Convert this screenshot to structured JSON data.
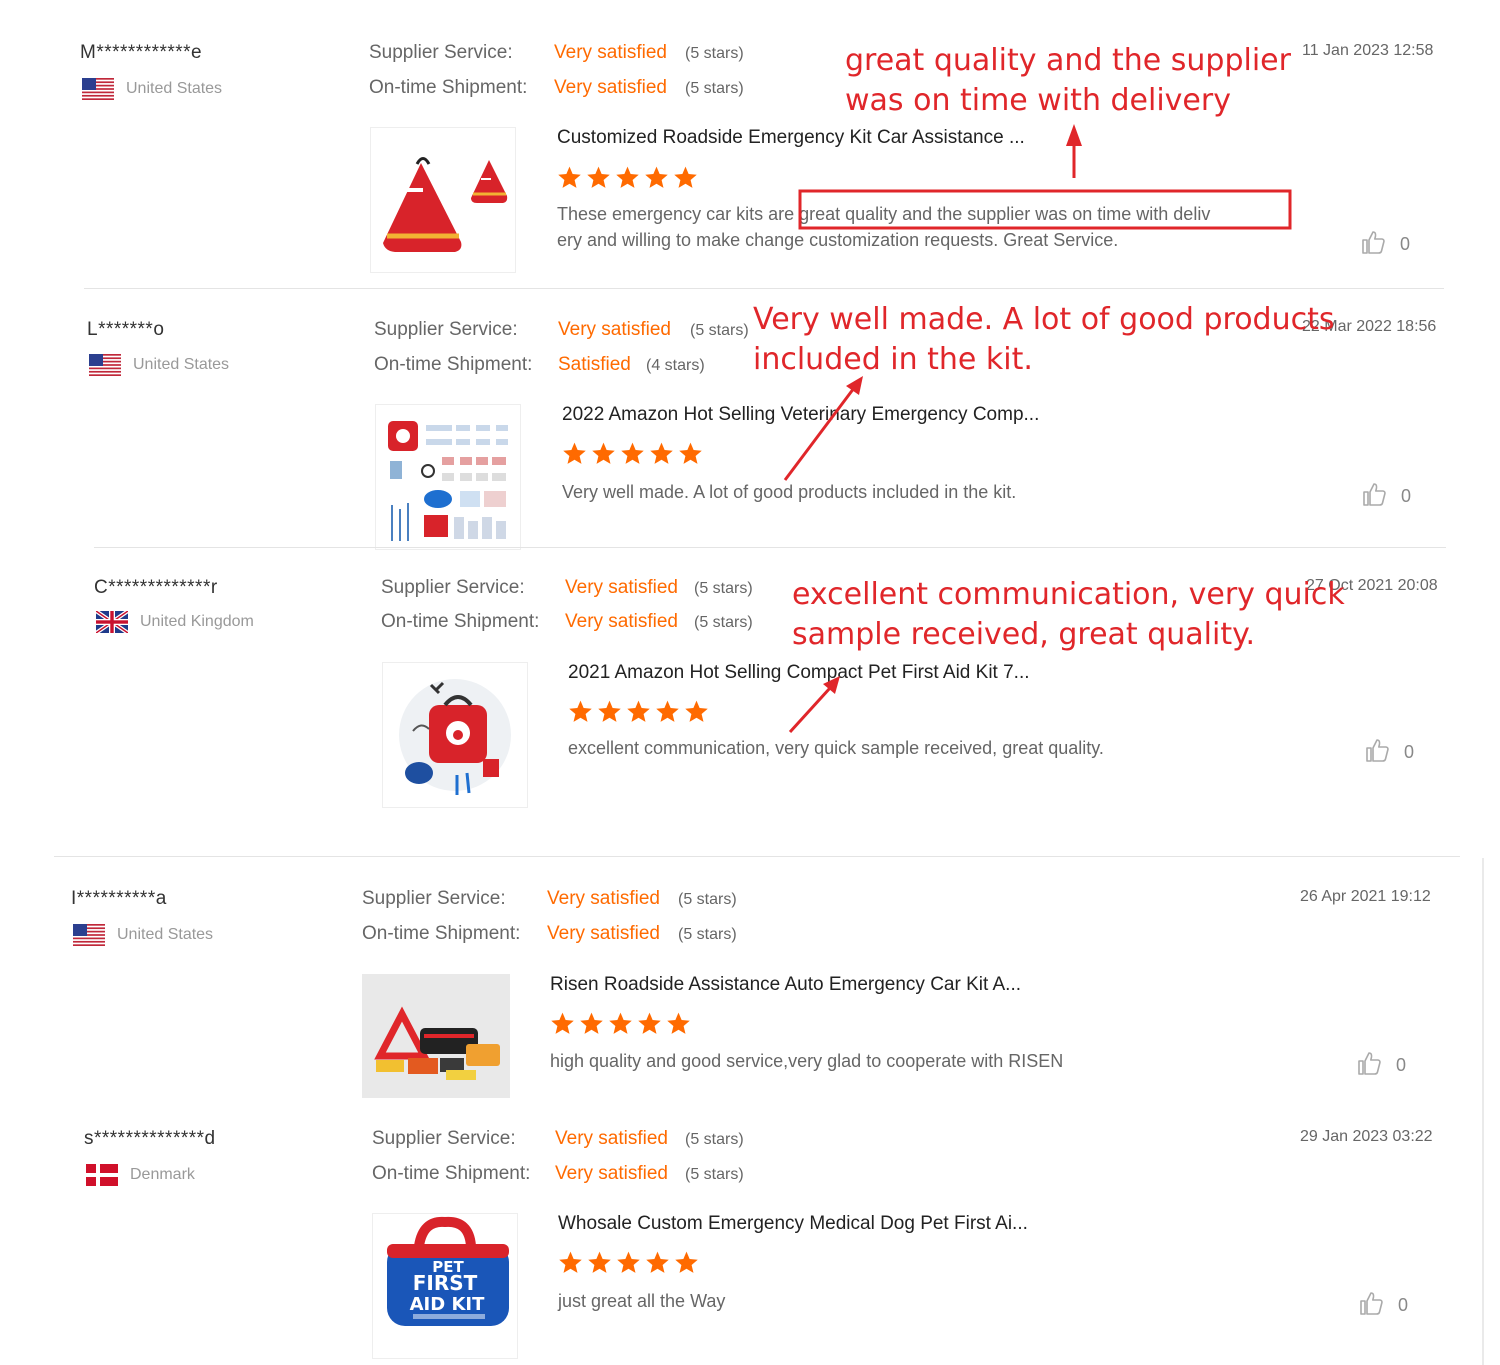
{
  "labels": {
    "supplier_service": "Supplier Service:",
    "on_time_shipment": "On-time Shipment:"
  },
  "colors": {
    "rating_orange": "#ff6a00",
    "star_orange": "#ff6a00",
    "annotation_red": "#e0262a"
  },
  "reviews": [
    {
      "buyer": "M************e",
      "country": "United States",
      "flag": "us-flag-icon",
      "supplier_rating": "Very satisfied",
      "supplier_stars": "(5 stars)",
      "shipment_rating": "Very satisfied",
      "shipment_stars": "(5 stars)",
      "date": "11 Jan 2023 12:58",
      "product": "Customized Roadside Emergency Kit Car Assistance ...",
      "product_stars": 5,
      "comment_line1": "These emergency car kits are great quality and the supplier was on time with deliv",
      "comment_line2": "ery and willing to make change customization requests. Great Service.",
      "likes": "0"
    },
    {
      "buyer": "L*******o",
      "country": "United States",
      "flag": "us-flag-icon",
      "supplier_rating": "Very satisfied",
      "supplier_stars": "(5 stars)",
      "shipment_rating": "Satisfied",
      "shipment_stars": "(4 stars)",
      "date": "22 Mar 2022 18:56",
      "product": "2022 Amazon Hot Selling Veterinary Emergency Comp...",
      "product_stars": 5,
      "comment_line1": "Very well made. A lot of good products included in the kit.",
      "comment_line2": "",
      "likes": "0"
    },
    {
      "buyer": "C*************r",
      "country": "United Kingdom",
      "flag": "uk-flag-icon",
      "supplier_rating": "Very satisfied",
      "supplier_stars": "(5 stars)",
      "shipment_rating": "Very satisfied",
      "shipment_stars": "(5 stars)",
      "date": "27 Oct 2021 20:08",
      "product": "2021 Amazon Hot Selling Compact Pet First Aid Kit 7...",
      "product_stars": 5,
      "comment_line1": "excellent communication, very quick sample received, great quality.",
      "comment_line2": "",
      "likes": "0"
    },
    {
      "buyer": "I**********a",
      "country": "United States",
      "flag": "us-flag-icon",
      "supplier_rating": "Very satisfied",
      "supplier_stars": "(5 stars)",
      "shipment_rating": "Very satisfied",
      "shipment_stars": "(5 stars)",
      "date": "26 Apr 2021 19:12",
      "product": "Risen Roadside Assistance Auto Emergency Car Kit A...",
      "product_stars": 5,
      "comment_line1": "high quality and good service,very glad to cooperate with RISEN",
      "comment_line2": "",
      "likes": "0"
    },
    {
      "buyer": "s**************d",
      "country": "Denmark",
      "flag": "dk-flag-icon",
      "supplier_rating": "Very satisfied",
      "supplier_stars": "(5 stars)",
      "shipment_rating": "Very satisfied",
      "shipment_stars": "(5 stars)",
      "date": "29 Jan 2023 03:22",
      "product": "Whosale Custom Emergency Medical Dog Pet First Ai...",
      "product_stars": 5,
      "comment_line1": "just great all the Way",
      "comment_line2": "",
      "likes": "0"
    }
  ],
  "annotations": [
    {
      "line1": "great quality and the supplier",
      "line2": "was on time with delivery"
    },
    {
      "line1": "Very well made. A lot of good products",
      "line2": "included in the kit."
    },
    {
      "line1": "excellent communication, very quick",
      "line2": "sample received, great quality."
    }
  ],
  "product_images": {
    "img1": "red emergency bag",
    "img2": "veterinary kit contents",
    "img3": "pet first aid kit",
    "img4": "car emergency kit",
    "img5": {
      "line1": "PET",
      "line2": "FIRST",
      "line3": "AID KIT"
    }
  }
}
